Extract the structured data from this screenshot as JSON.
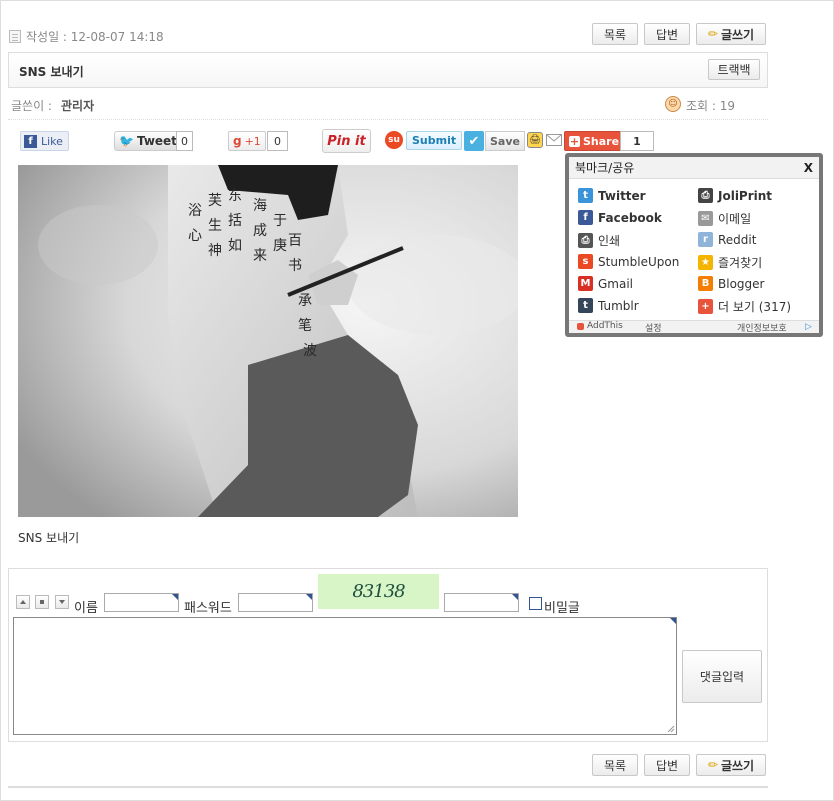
{
  "meta": {
    "date_label": "작성일 : 12-08-07 14:18",
    "author_prefix": "글쓴이 :",
    "author_name": "관리자",
    "views_label": "조회 : 19"
  },
  "toolbar": {
    "list_label": "목록",
    "reply_label": "답변",
    "write_label": "글쓰기"
  },
  "post": {
    "title": "SNS 보내기",
    "trackback_label": "트랙백",
    "body_text": "SNS 보내기"
  },
  "sns": {
    "like_label": "Like",
    "tweet_label": "Tweet",
    "tweet_count": "0",
    "gplus_label": "+1",
    "gplus_count": "0",
    "pinit_label": "Pin it",
    "submit_label": "Submit",
    "save_label": "Save",
    "share_label": "Share",
    "share_count": "1"
  },
  "share_panel": {
    "title": "북마크/공유",
    "close_label": "X",
    "items": [
      {
        "label": "Twitter",
        "bold": true,
        "icon": "twitter-icon",
        "color": "#3b94d9"
      },
      {
        "label": "JoliPrint",
        "bold": true,
        "icon": "joliprint-icon",
        "color": "#444444"
      },
      {
        "label": "Facebook",
        "bold": true,
        "icon": "facebook-icon",
        "color": "#3b5998"
      },
      {
        "label": "이메일",
        "bold": false,
        "icon": "email-icon",
        "color": "#999999"
      },
      {
        "label": "인쇄",
        "bold": false,
        "icon": "print-icon",
        "color": "#555555"
      },
      {
        "label": "Reddit",
        "bold": false,
        "icon": "reddit-icon",
        "color": "#8fb3d9"
      },
      {
        "label": "StumbleUpon",
        "bold": false,
        "icon": "stumbleupon-icon",
        "color": "#eb4924"
      },
      {
        "label": "즐겨찾기",
        "bold": false,
        "icon": "favorites-icon",
        "color": "#f5b400"
      },
      {
        "label": "Gmail",
        "bold": false,
        "icon": "gmail-icon",
        "color": "#d93025"
      },
      {
        "label": "Blogger",
        "bold": false,
        "icon": "blogger-icon",
        "color": "#f57d00"
      },
      {
        "label": "Tumblr",
        "bold": false,
        "icon": "tumblr-icon",
        "color": "#35465c"
      },
      {
        "label": "더 보기 (317)",
        "bold": false,
        "icon": "more-icon",
        "color": "#e8533b"
      }
    ],
    "footer_brand": "AddThis",
    "footer_settings": "설정",
    "footer_privacy": "개인정보보호"
  },
  "comment": {
    "name_label": "이름",
    "password_label": "패스워드",
    "captcha_text": "83138",
    "secret_label": "비밀글",
    "submit_label": "댓글입력"
  },
  "colors": {
    "share_orange": "#e8533b",
    "facebook": "#3b5998",
    "twitter": "#3b94d9"
  }
}
